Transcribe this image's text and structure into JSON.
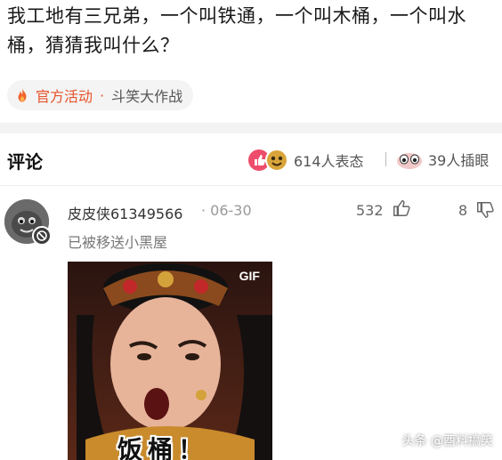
{
  "post": {
    "text": "我工地有三兄弟，一个叫铁通，一个叫木桶，一个叫水桶，猜猜我叫什么？"
  },
  "topic": {
    "name": "官方活动",
    "separator": "·",
    "subtitle": "斗笑大作战"
  },
  "comments_header": {
    "title": "评论",
    "reactions": "614人表态",
    "views": "39人插眼"
  },
  "comment": {
    "username": "皮皮侠61349566",
    "timestamp": "· 06-30",
    "like_count": "532",
    "dislike_count": "8",
    "status": "已被移送小黑屋",
    "gif_badge": "GIF",
    "gif_caption": "饭桶！"
  },
  "watermark": "头条 @酉料搞笑",
  "colors": {
    "accent": "#e6532a",
    "divider": "#f3f3f3"
  }
}
